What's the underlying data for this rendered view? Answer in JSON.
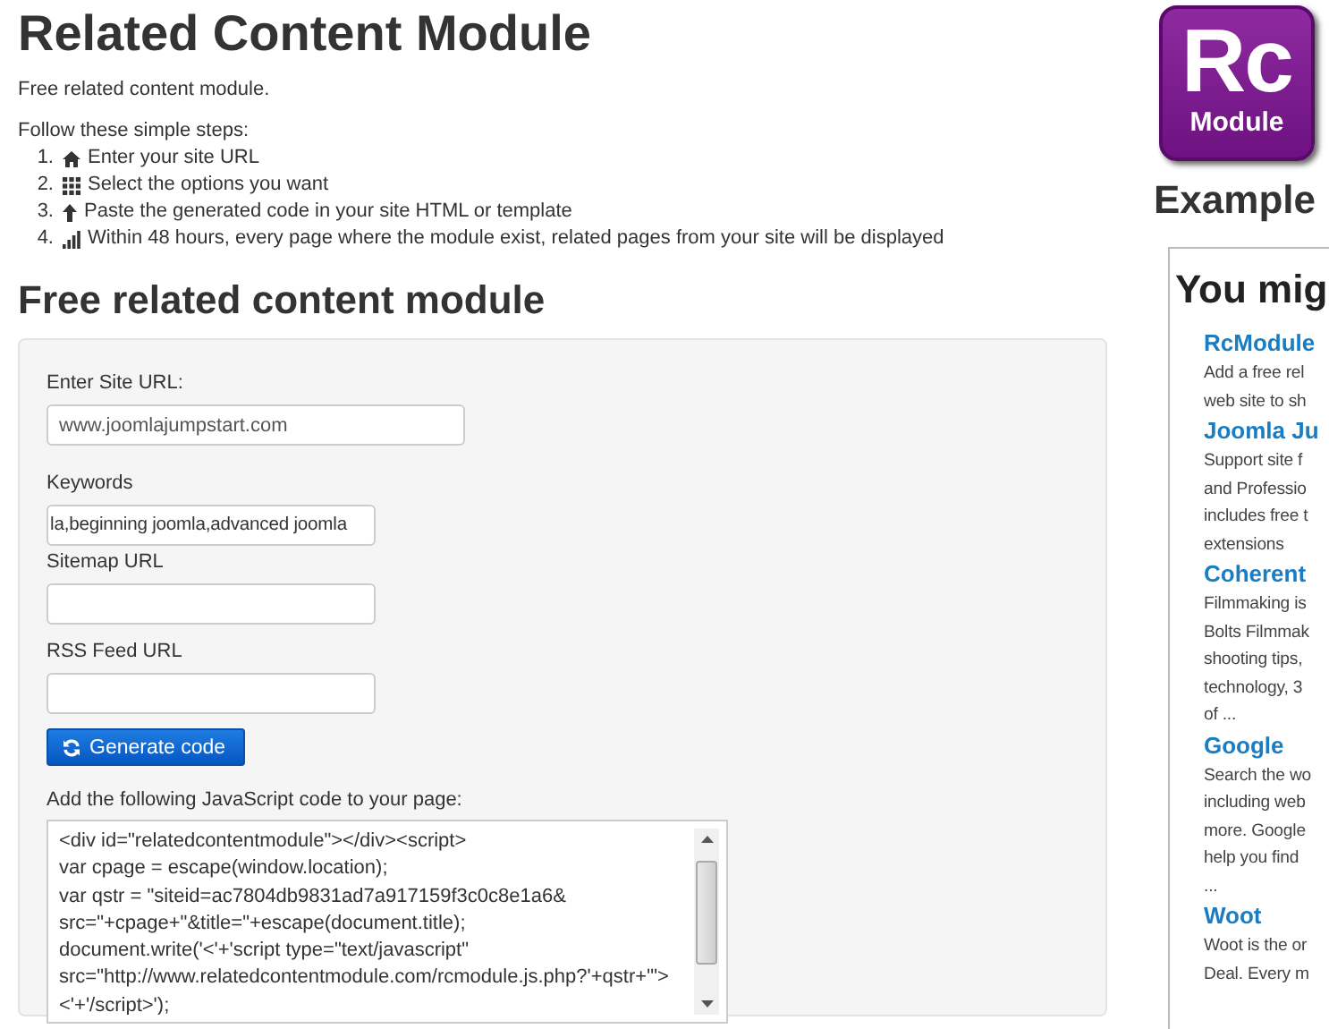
{
  "page": {
    "title": "Related Content Module",
    "intro": "Free related content module.",
    "steps_heading": "Follow these simple steps:"
  },
  "steps": [
    {
      "number": "1.",
      "text": "Enter your site URL"
    },
    {
      "number": "2.",
      "text": "Select the options you want"
    },
    {
      "number": "3.",
      "text": "Paste the generated code in your site HTML or template"
    },
    {
      "number": "4.",
      "text": "Within 48 hours, every page where the module exist, related pages from your site will be displayed"
    }
  ],
  "form": {
    "heading": "Free related content module",
    "fields": [
      {
        "label": "Enter Site URL:",
        "value": "www.joomlajumpstart.com"
      },
      {
        "label": "Keywords",
        "value": "la,beginning joomla,advanced joomla"
      },
      {
        "label": "Sitemap URL"
      },
      {
        "label": "RSS Feed URL"
      }
    ],
    "button": "Generate code",
    "code_label": "Add the following JavaScript code to your page:",
    "code_lines": [
      "<div id=\"relatedcontentmodule\"></div><script>",
      "var cpage = escape(window.location);",
      "var qstr = \"siteid=ac7804db9831ad7a917159f3c0c8e1a6&",
      "src=\"+cpage+\"&title=\"+escape(document.title);",
      "document.write('<'+'script type=\"text/javascript\"",
      "src=\"http://www.relatedcontentmodule.com/rcmodule.js.php?'+qstr+'\">",
      "<'+'/script>');"
    ]
  },
  "logo": {
    "main": "Rc",
    "sub": "Module"
  },
  "example": {
    "heading": "Example",
    "box_heading": "You mig",
    "items": [
      {
        "title": "RcModule",
        "lines": [
          "Add a free rel",
          "web site to sh"
        ]
      },
      {
        "title": "Joomla Ju",
        "lines": [
          "Support site f",
          "and Professio",
          "includes free t",
          "extensions"
        ]
      },
      {
        "title": "Coherent",
        "lines": [
          "Filmmaking is",
          "Bolts Filmmak",
          "shooting tips,",
          "technology, 3",
          "of ..."
        ]
      },
      {
        "title": "Google",
        "lines": [
          "Search the wo",
          "including web",
          "more. Google",
          "help you find",
          "..."
        ]
      },
      {
        "title": "Woot",
        "lines": [
          "Woot is the or",
          "Deal. Every m"
        ]
      }
    ]
  }
}
